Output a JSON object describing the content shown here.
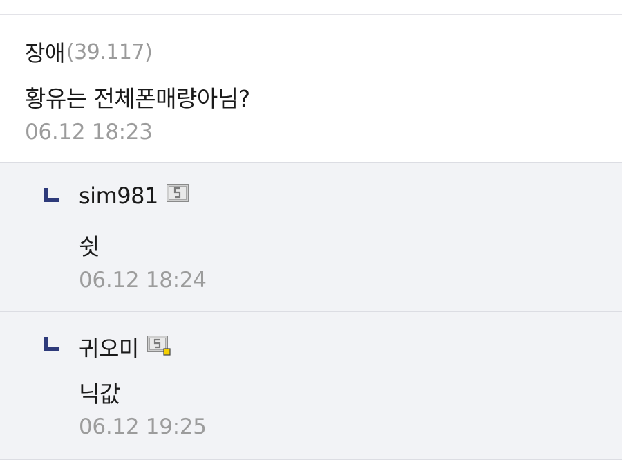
{
  "comments": [
    {
      "author": "장애",
      "ip": "(39.117)",
      "text": "황유는 전체폰매량아님?",
      "time": "06.12 18:23"
    }
  ],
  "replies": [
    {
      "author": "sim981",
      "icon": "fixed-nick-icon",
      "text": "쉿",
      "time": "06.12 18:24"
    },
    {
      "author": "귀오미",
      "icon": "fixed-nick-sub-manager-icon",
      "text": "닉값",
      "time": "06.12 19:25"
    }
  ],
  "colors": {
    "reply_background": "#f2f3f6",
    "reply_arrow": "#2e3a7a",
    "timestamp": "#9c9c9c",
    "ip": "#9a9a9a",
    "icon_badge_yellow": "#f5d000"
  }
}
